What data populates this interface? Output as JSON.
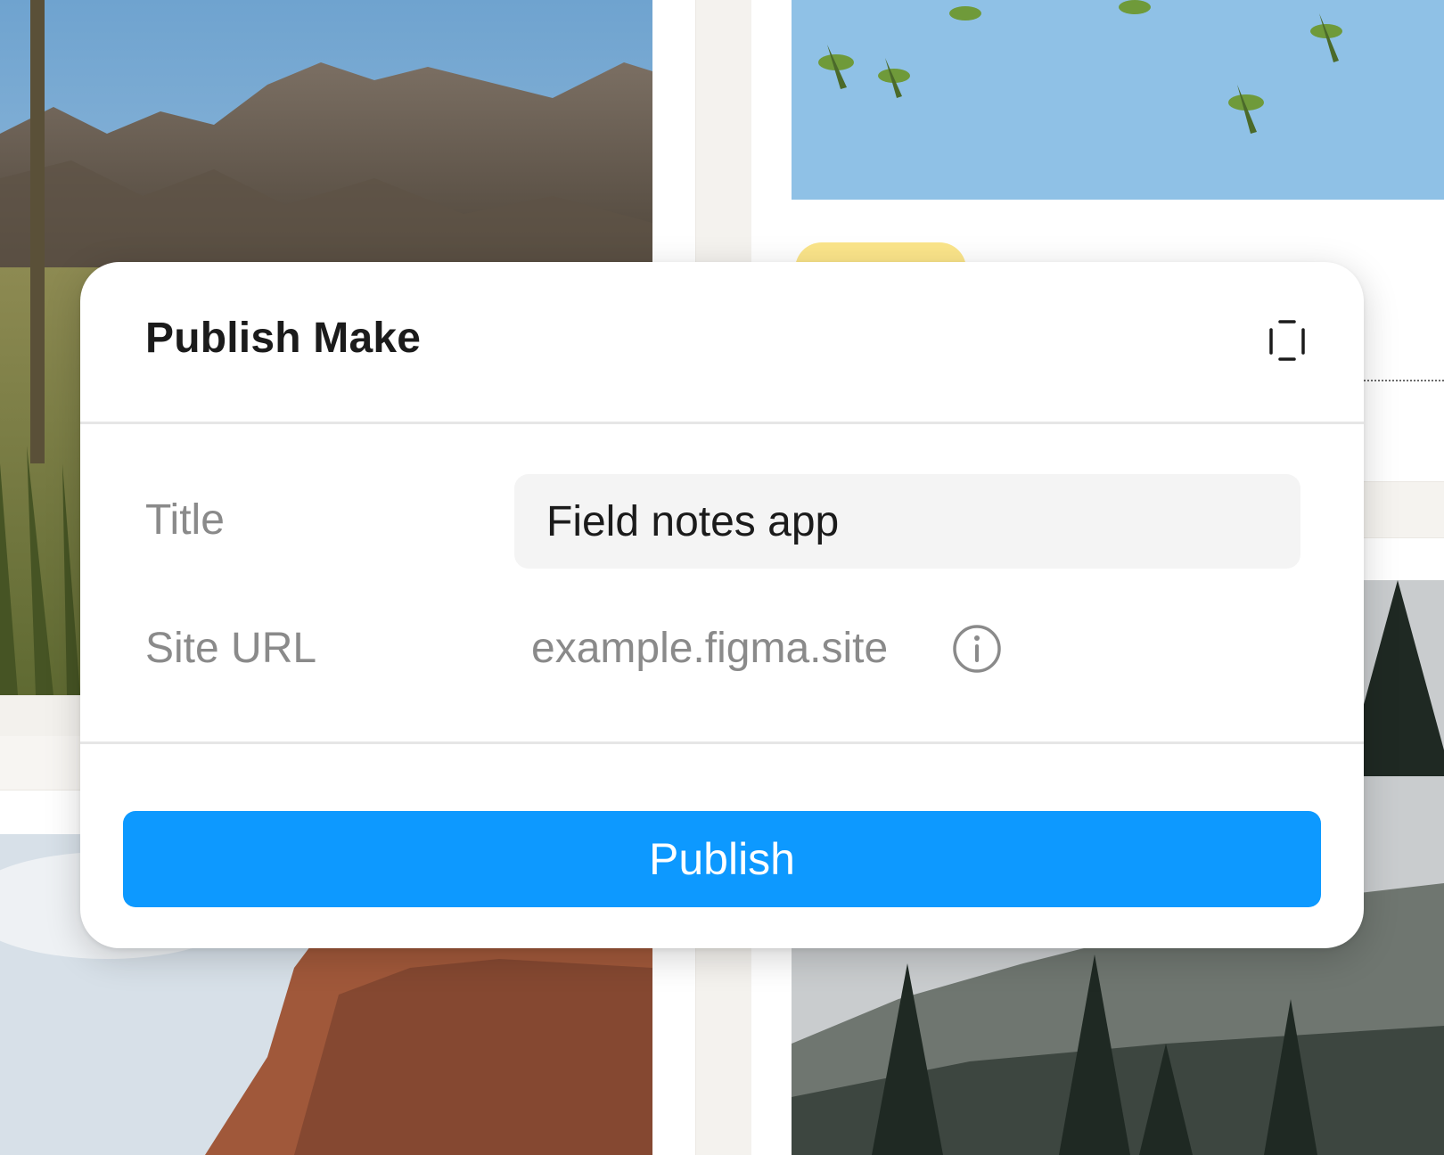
{
  "modal": {
    "title": "Publish Make",
    "expand_icon": "expand-icon",
    "fields": {
      "title_label": "Title",
      "title_value": "Field notes app",
      "url_label": "Site URL",
      "url_value": "example.figma.site",
      "info_icon": "info-icon"
    },
    "publish_label": "Publish"
  },
  "colors": {
    "accent": "#0d99ff",
    "tag": "#fbe58a",
    "input_bg": "#f4f4f4"
  }
}
